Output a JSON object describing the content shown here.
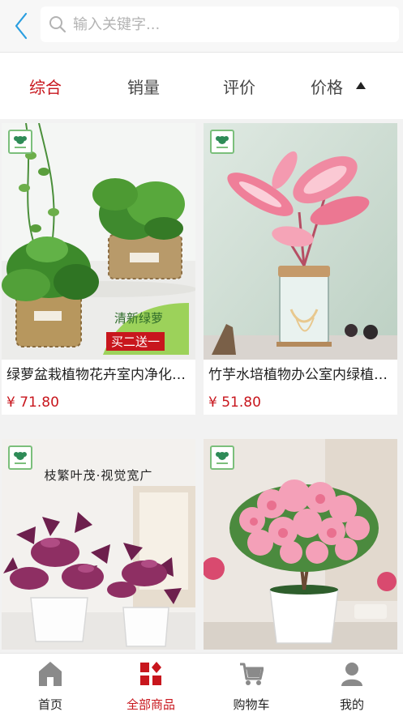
{
  "header": {
    "search_placeholder": "输入关键字..."
  },
  "sortbar": {
    "items": [
      {
        "label": "综合",
        "active": true
      },
      {
        "label": "销量",
        "active": false
      },
      {
        "label": "评价",
        "active": false
      },
      {
        "label": "价格",
        "active": false
      }
    ]
  },
  "products": [
    {
      "title": "绿萝盆栽植物花卉室内净化空气吸甲醛",
      "price": "¥ 71.80",
      "promo_top": "清新绿萝",
      "promo_bottom": "买二送一"
    },
    {
      "title": "竹芋水培植物办公室内绿植盆栽",
      "price": "¥ 51.80"
    },
    {
      "title": "",
      "price": "",
      "overlay": "枝繁叶茂·视觉宽广"
    },
    {
      "title": "",
      "price": ""
    }
  ],
  "tabbar": {
    "items": [
      {
        "label": "首页",
        "active": false
      },
      {
        "label": "全部商品",
        "active": true
      },
      {
        "label": "购物车",
        "active": false
      },
      {
        "label": "我的",
        "active": false
      }
    ]
  },
  "colors": {
    "accent": "#c8161d",
    "back_arrow": "#2a9ee0",
    "icon_gray": "#8a8a8a"
  }
}
